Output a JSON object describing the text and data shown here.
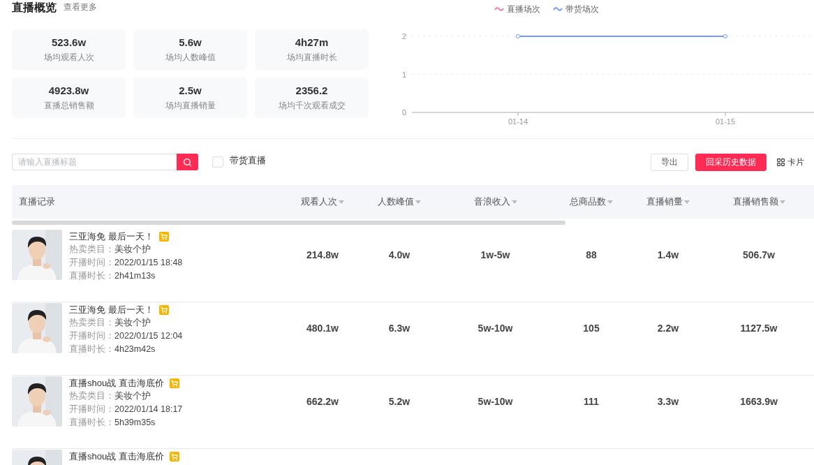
{
  "header": {
    "title": "直播概览",
    "link": "查看更多"
  },
  "stats": [
    {
      "value": "523.6w",
      "label": "场均观看人次"
    },
    {
      "value": "5.6w",
      "label": "场均人数峰值"
    },
    {
      "value": "4h27m",
      "label": "场均直播时长"
    },
    {
      "value": "4923.8w",
      "label": "直播总销售额"
    },
    {
      "value": "2.5w",
      "label": "场均直播销量"
    },
    {
      "value": "2356.2",
      "label": "场均千次观看成交"
    }
  ],
  "chart": {
    "chart_data": {
      "type": "line",
      "categories": [
        "01-14",
        "01-15"
      ],
      "ylim": [
        0,
        2
      ],
      "yticks": [
        0,
        1,
        2
      ],
      "series": [
        {
          "name": "带货场次",
          "color": "#6f9cf7",
          "values": [
            2,
            2
          ],
          "marker": true
        }
      ]
    },
    "legend": [
      {
        "name": "直播场次",
        "color": "#f7799c"
      }
    ]
  },
  "toolbar": {
    "search": {
      "placeholder": "请输入直播标题"
    },
    "filter": {
      "label": "带货直播",
      "checked": false
    },
    "buttons": [
      {
        "label": "导出",
        "kind": "outline"
      },
      {
        "label": "回采历史数据",
        "kind": "primary"
      }
    ],
    "view_toggle": {
      "label": "卡片"
    }
  },
  "table": {
    "columns": [
      {
        "label": "直播记录",
        "sortable": false
      },
      {
        "label": "观看人次",
        "sortable": true
      },
      {
        "label": "人数峰值",
        "sortable": true
      },
      {
        "label": "音浪收入",
        "sortable": true
      },
      {
        "label": "总商品数",
        "sortable": true
      },
      {
        "label": "直播销量",
        "sortable": true
      },
      {
        "label": "直播销售额",
        "sortable": true
      }
    ],
    "rows": [
      {
        "title": "三亚海免 最后一天！",
        "category_label": "热卖类目：",
        "category": "美妆个护",
        "start_label": "开播时间：",
        "start": "2022/01/15 18:48",
        "duration_label": "直播时长：",
        "duration": "2h41m13s",
        "values": [
          "214.8w",
          "4.0w",
          "1w-5w",
          "88",
          "1.4w",
          "506.7w"
        ]
      },
      {
        "title": "三亚海免 最后一天！",
        "category_label": "热卖类目：",
        "category": "美妆个护",
        "start_label": "开播时间：",
        "start": "2022/01/15 12:04",
        "duration_label": "直播时长：",
        "duration": "4h23m42s",
        "values": [
          "480.1w",
          "6.3w",
          "5w-10w",
          "105",
          "2.2w",
          "1127.5w"
        ]
      },
      {
        "title": "直播shou战 直击海底价",
        "category_label": "热卖类目：",
        "category": "美妆个护",
        "start_label": "开播时间：",
        "start": "2022/01/14 18:17",
        "duration_label": "直播时长：",
        "duration": "5h39m35s",
        "values": [
          "662.2w",
          "5.2w",
          "5w-10w",
          "111",
          "3.3w",
          "1663.9w"
        ]
      },
      {
        "title": "直播shou战 直击海底价"
      }
    ]
  }
}
